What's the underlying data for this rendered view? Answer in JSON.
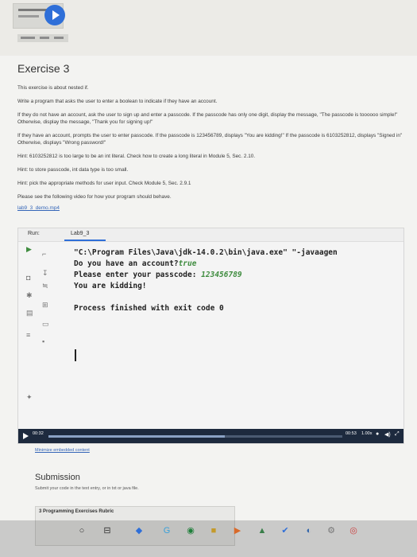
{
  "exercise": {
    "title": "Exercise 3",
    "paragraphs": [
      "This exercise is about nested if.",
      "Write a program that asks the user to enter a boolean to indicate if they have an account.",
      "If they do not have an account, ask the user to sign up and enter a passcode. If the passcode has only one digit, display the message, \"The passcode is toooooo simple!\" Otherwise, display the message, \"Thank you for signing up!\"",
      "If they have an account, prompts the user to enter passcode. If the passcode is 123456789, displays \"You are kidding!\" If the passcode is 6103252812, displays \"Signed in\" Otherwise, displays \"Wrong password!\"",
      "Hint: 6103252812 is too large to be an int literal. Check how to create a long literal in Module 5, Sec. 2.10.",
      "Hint: to store passcode, int data type is too small.",
      "Hint: pick the appropriate methods for user input. Check Module 5, Sec. 2.9.1",
      "Please see the following video for how your program should behave."
    ],
    "video_link": "lab9_3_demo.mp4"
  },
  "video": {
    "run_label": "Run:",
    "tab_name": "Lab9_3",
    "console_line1": "\"C:\\Program Files\\Java\\jdk-14.0.2\\bin\\java.exe\" \"-javaagen",
    "console_line2_prefix": "Do you have an account?",
    "console_line2_input": "true",
    "console_line3_prefix": "Please enter your passcode: ",
    "console_line3_input": "123456789",
    "console_line4": "You are kidding!",
    "console_line5": "Process finished with exit code 0",
    "time_current": "00:32",
    "time_total": "00:53",
    "speed": "1.00x",
    "progress": 0.6
  },
  "minimize_link": "Minimize embedded content",
  "submission": {
    "title": "Submission",
    "text": "Submit your code in the text entry, or in txt or java file."
  },
  "rubric": {
    "label": "3 Programming Exercises Rubric"
  }
}
